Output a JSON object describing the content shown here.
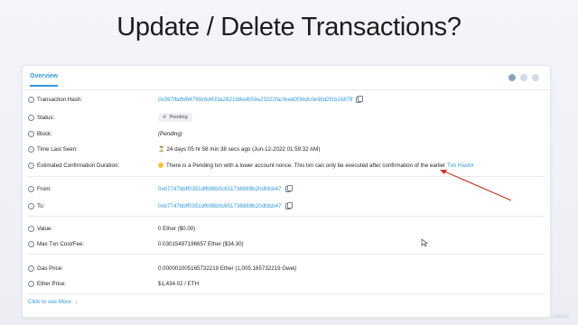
{
  "slide_title": "Update / Delete Transactions?",
  "tabs": {
    "overview": "Overview"
  },
  "rows": {
    "tx_hash": {
      "label": "Transaction Hash:",
      "value": "0x397fbdfd64799c6d433a2821b8ed659a23222facfeed0f36dc0e9bd2f1b16878"
    },
    "status": {
      "label": "Status:",
      "badge": "Pending"
    },
    "block": {
      "label": "Block:",
      "value": "(Pending)"
    },
    "time_last_seen": {
      "label": "Time Last Seen:",
      "value": "24 days 05 hr 58 min 38 secs ago (Jun-12-2022 01:59:32 AM)"
    },
    "confirmation": {
      "label": "Estimated Confirmation Duration:",
      "text": "There is a Pending txn with a lower account nonce. This txn can only be executed after confirmation of the earlier",
      "link": "Txn Hash#"
    },
    "from": {
      "label": "From:",
      "value": "0xb7747bbff0351df698b0c651736889b20dfdcb47"
    },
    "to": {
      "label": "To:",
      "value": "0xb7747bbff0351df698b0c651736889b20dfdcb47"
    },
    "value": {
      "label": "Value:",
      "value": "0 Ether ($0.00)"
    },
    "max_txn_cost": {
      "label": "Max Txn Cost/Fee:",
      "value": "0.03015497196657 Ether ($34.30)"
    },
    "gas_price": {
      "label": "Gas Price:",
      "value": "0.000001005165732219 Ether (1,005.165732219 Gwei)"
    },
    "ether_price": {
      "label": "Ether Price:",
      "value": "$1,434.02 / ETH"
    }
  },
  "see_more": "Click to see More",
  "watermark": "Udemy",
  "colors": {
    "link": "#3498db",
    "annotation_arrow": "#c0392b",
    "badge_bg": "#eef0f3"
  },
  "icons": {
    "help": "question-circle-icon",
    "copy": "copy-icon",
    "pending": "gear-icon",
    "time": "hourglass-icon",
    "warning": "emoji-icon",
    "more": "arrow-down-icon"
  }
}
